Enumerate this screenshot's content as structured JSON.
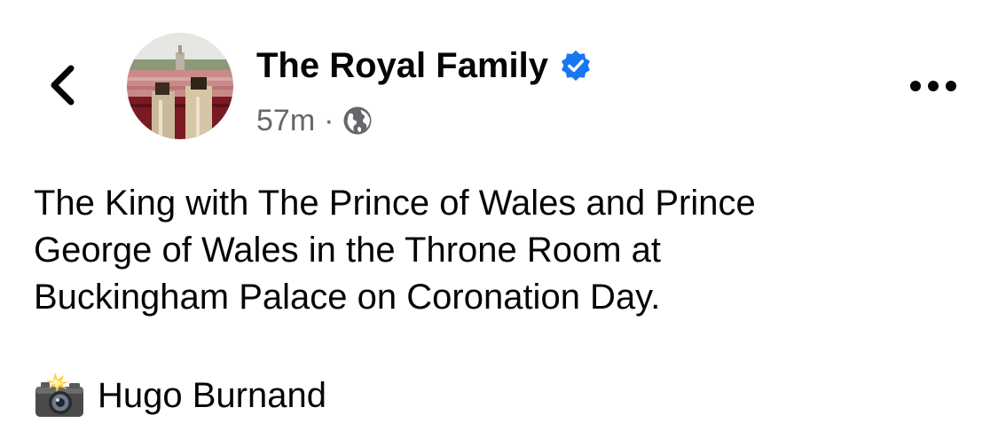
{
  "header": {
    "back_icon": "chevron-left-icon",
    "author_name": "The Royal Family",
    "verified_icon": "verified-badge-icon",
    "timestamp": "57m",
    "separator": "·",
    "audience_icon": "globe-icon",
    "more_icon": "more-horizontal-icon"
  },
  "post": {
    "text": "The King with The Prince of Wales and Prince\nGeorge of Wales in the Throne Room at\nBuckingham Palace on Coronation Day.",
    "credit_icon": "camera-with-flash-icon",
    "credit_name": "Hugo Burnand"
  },
  "colors": {
    "verified_blue": "#1877f2",
    "secondary_text": "#65676b",
    "primary_text": "#050505"
  }
}
